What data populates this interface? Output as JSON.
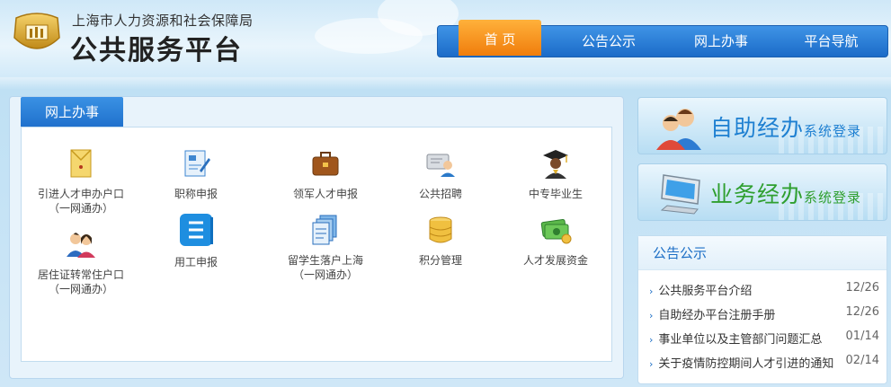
{
  "header": {
    "org_name": "上海市人力资源和社会保障局",
    "platform_name": "公共服务平台",
    "nav": [
      {
        "label": "首 页",
        "active": true
      },
      {
        "label": "公告公示",
        "active": false
      },
      {
        "label": "网上办事",
        "active": false
      },
      {
        "label": "平台导航",
        "active": false
      }
    ]
  },
  "services_panel": {
    "tab_label": "网上办事",
    "items": [
      {
        "label": "引进人才申办户口",
        "sub": "（一网通办）",
        "icon": "envelope-file-icon"
      },
      {
        "label": "职称申报",
        "sub": "",
        "icon": "certificate-pen-icon"
      },
      {
        "label": "领军人才申报",
        "sub": "",
        "icon": "briefcase-icon"
      },
      {
        "label": "公共招聘",
        "sub": "",
        "icon": "id-card-person-icon"
      },
      {
        "label": "中专毕业生",
        "sub": "",
        "icon": "graduate-icon"
      },
      {
        "label": "居住证转常住户口",
        "sub": "（一网通办）",
        "icon": "couple-icon"
      },
      {
        "label": "用工申报",
        "sub": "",
        "icon": "document-list-icon"
      },
      {
        "label": "留学生落户上海",
        "sub": "（一网通办）",
        "icon": "stacked-documents-icon"
      },
      {
        "label": "积分管理",
        "sub": "",
        "icon": "coin-stack-icon"
      },
      {
        "label": "人才发展资金",
        "sub": "",
        "icon": "money-icon"
      }
    ]
  },
  "login": {
    "self_service": {
      "big": "自助经办",
      "small": "系统登录"
    },
    "business": {
      "big": "业务经办",
      "small": "系统登录"
    }
  },
  "notice": {
    "title": "公告公示",
    "items": [
      {
        "text": "公共服务平台介绍",
        "date": "12/26"
      },
      {
        "text": "自助经办平台注册手册",
        "date": "12/26"
      },
      {
        "text": "事业单位以及主管部门问题汇总",
        "date": "01/14"
      },
      {
        "text": "关于疫情防控期间人才引进的通知",
        "date": "02/14"
      }
    ]
  },
  "colors": {
    "nav_blue": "#1f70cc",
    "nav_active": "#f07d0c",
    "accent_blue": "#1d7fd1",
    "accent_green": "#2f9f2f"
  }
}
